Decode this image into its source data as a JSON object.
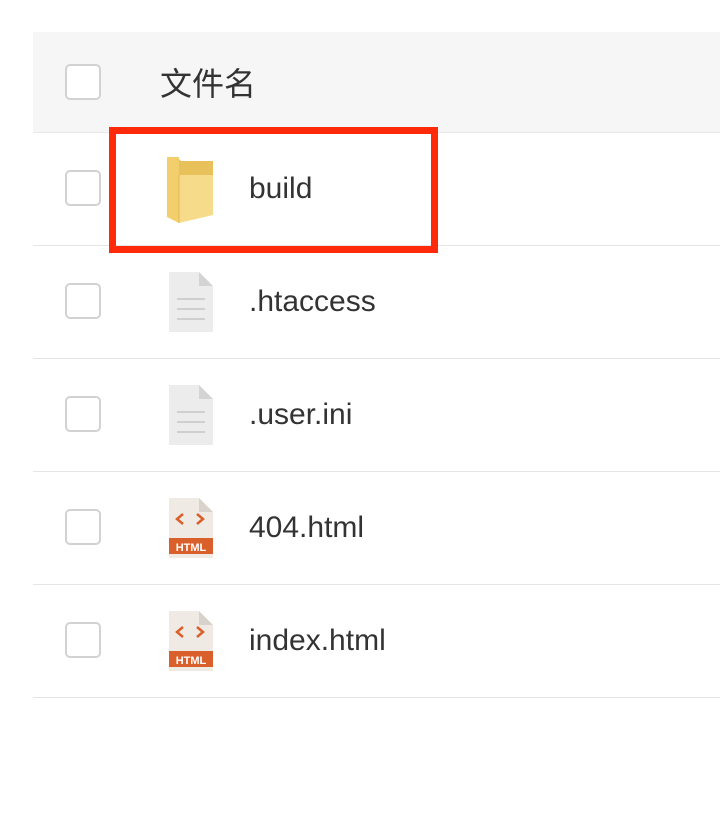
{
  "header": {
    "column_label": "文件名"
  },
  "files": [
    {
      "name": "build",
      "icon": "folder-icon"
    },
    {
      "name": ".htaccess",
      "icon": "text-file-icon"
    },
    {
      "name": ".user.ini",
      "icon": "text-file-icon"
    },
    {
      "name": "404.html",
      "icon": "html-file-icon",
      "badge": "HTML"
    },
    {
      "name": "index.html",
      "icon": "html-file-icon",
      "badge": "HTML"
    }
  ],
  "colors": {
    "highlight": "#ff2a0a",
    "folder": "#f5d77e",
    "html_accent": "#d95f2b",
    "header_bg": "#f6f6f6"
  }
}
